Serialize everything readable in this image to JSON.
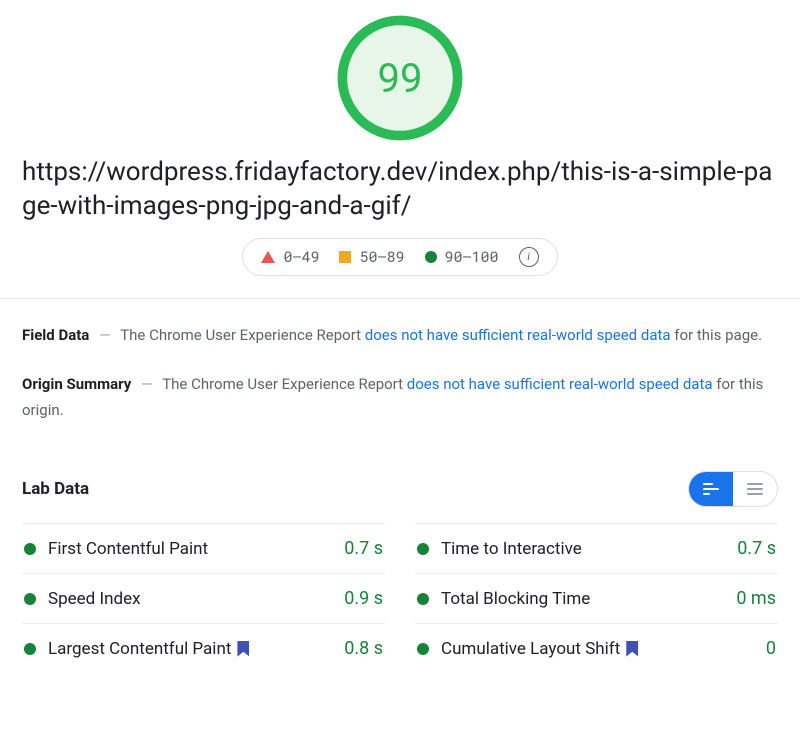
{
  "score": "99",
  "scorePercent": 99,
  "url": "https://wordpress.fridayfactory.dev/index.php/this-is-a-simple-page-with-images-png-jpg-and-a-gif/",
  "legend": {
    "poor": "0–49",
    "mid": "50–89",
    "good": "90–100"
  },
  "fieldData": {
    "label": "Field Data",
    "pre": "The Chrome User Experience Report ",
    "link": "does not have sufficient real-world speed data",
    "post": " for this page."
  },
  "originSummary": {
    "label": "Origin Summary",
    "pre": "The Chrome User Experience Report ",
    "link": "does not have sufficient real-world speed data",
    "post": " for this origin."
  },
  "labData": {
    "heading": "Lab Data",
    "metrics": {
      "fcp": {
        "name": "First Contentful Paint",
        "value": "0.7 s",
        "flag": false
      },
      "tti": {
        "name": "Time to Interactive",
        "value": "0.7 s",
        "flag": false
      },
      "si": {
        "name": "Speed Index",
        "value": "0.9 s",
        "flag": false
      },
      "tbt": {
        "name": "Total Blocking Time",
        "value": "0 ms",
        "flag": false
      },
      "lcp": {
        "name": "Largest Contentful Paint",
        "value": "0.8 s",
        "flag": true
      },
      "cls": {
        "name": "Cumulative Layout Shift",
        "value": "0",
        "flag": true
      }
    }
  }
}
